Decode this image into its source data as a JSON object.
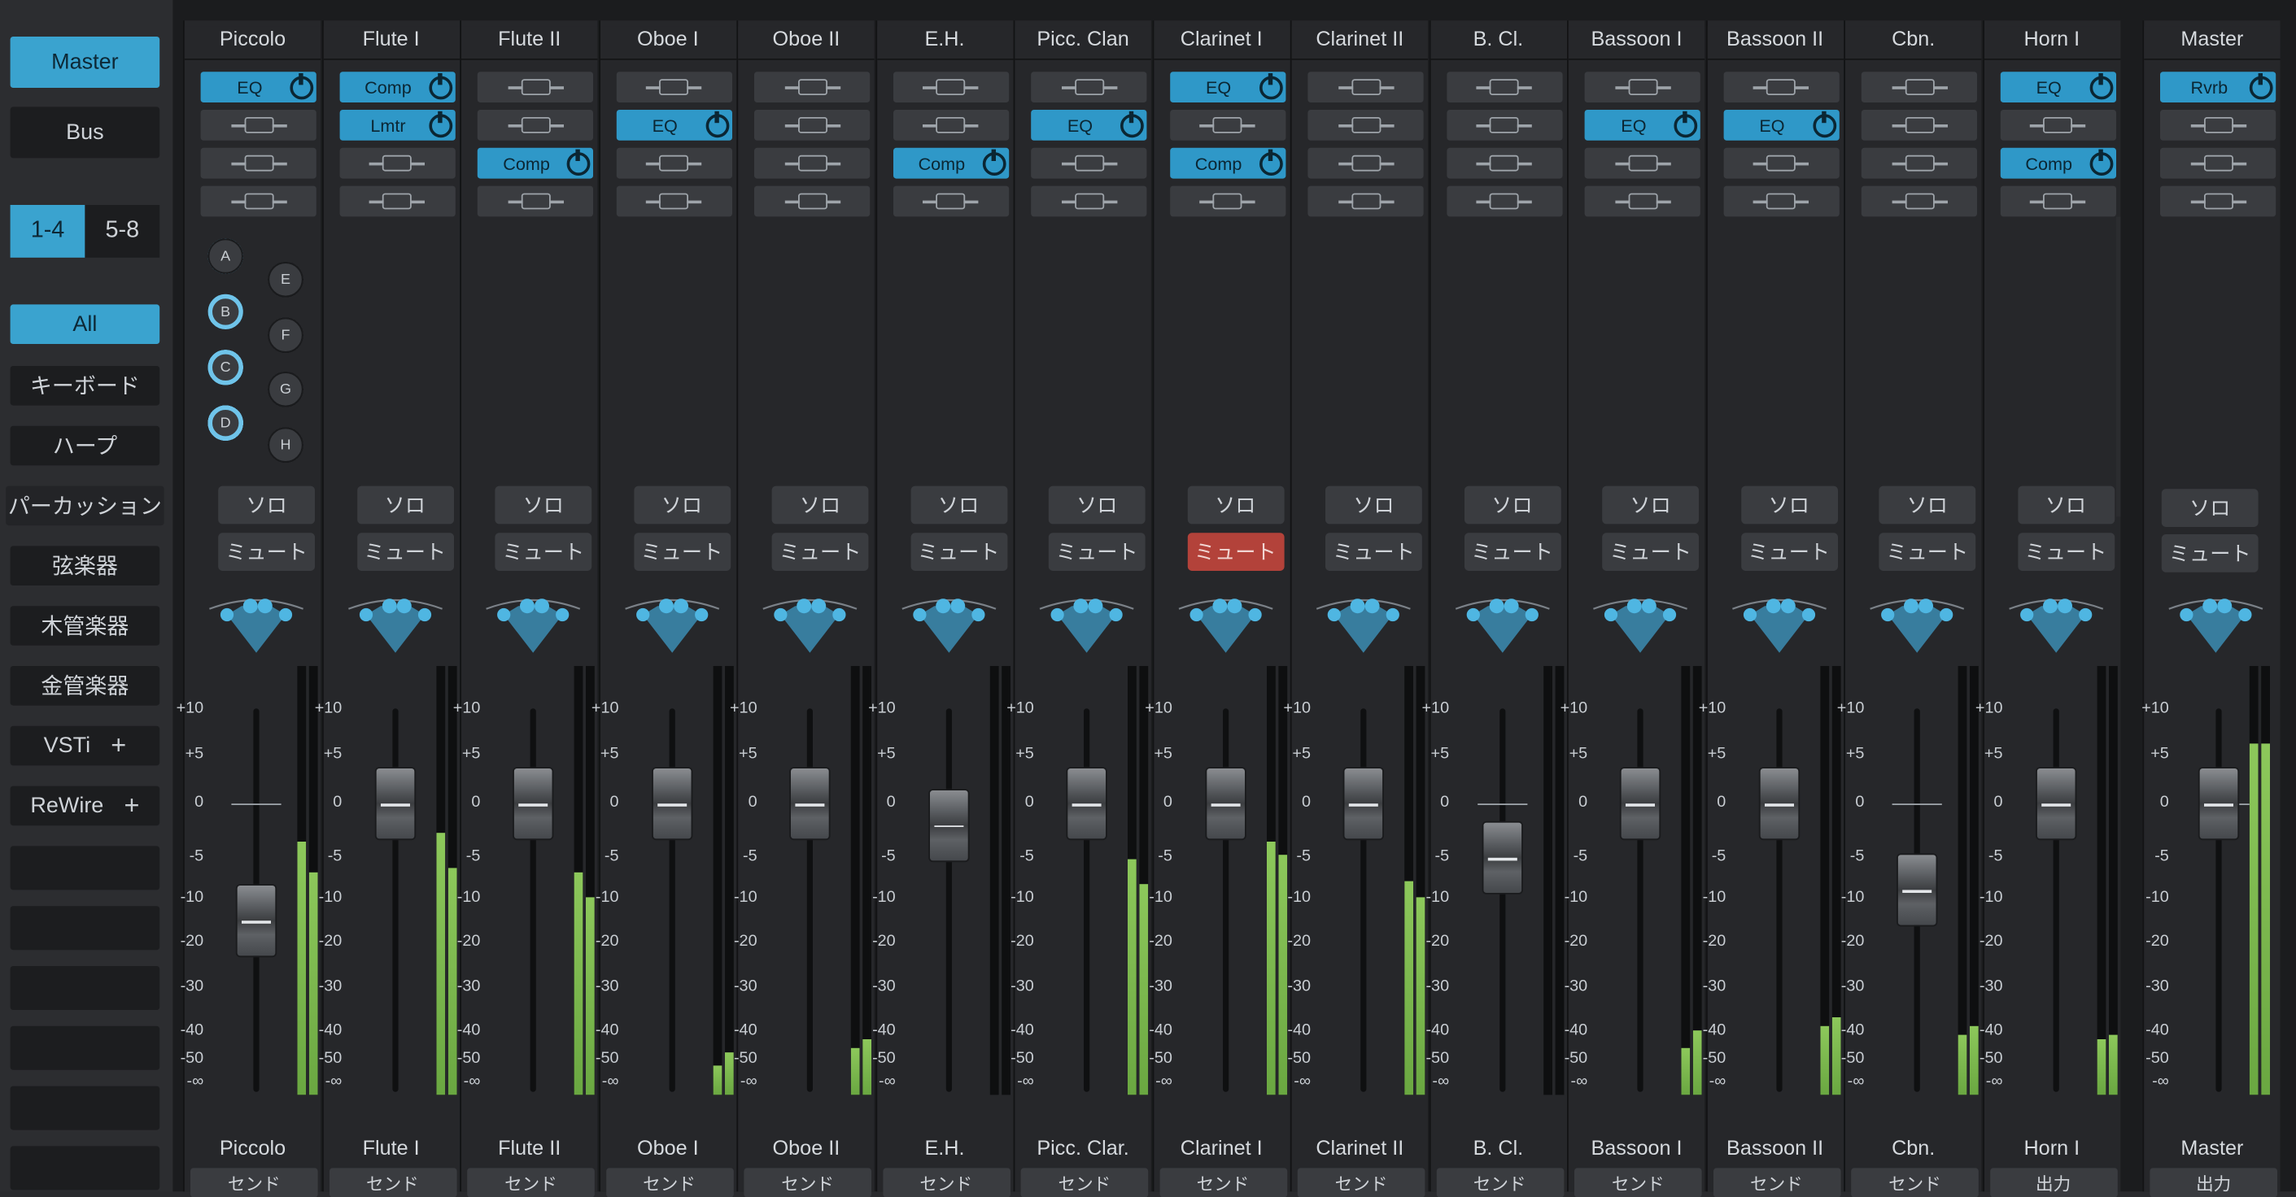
{
  "sidebar": {
    "master_label": "Master",
    "bus_label": "Bus",
    "bank_left": "1-4",
    "bank_right": "5-8",
    "categories": [
      "All",
      "キーボード",
      "ハープ",
      "パーカッション",
      "弦楽器",
      "木管楽器",
      "金管楽器"
    ],
    "vsti_label": "VSTi",
    "rewire_label": "ReWire"
  },
  "channels": [
    {
      "name": "Piccolo",
      "footer": "Piccolo",
      "send": "センド",
      "inserts": [
        "EQ",
        "",
        "",
        ""
      ],
      "sends_on": [
        true,
        false,
        false,
        true,
        false,
        false,
        false,
        false
      ],
      "muted": false,
      "fader_db": -15,
      "meter_level": [
        0.59,
        0.52
      ]
    },
    {
      "name": "Flute I",
      "footer": "Flute I",
      "send": "センド",
      "inserts": [
        "Comp",
        "Lmtr",
        "",
        ""
      ],
      "sends_on": [
        true,
        false,
        false,
        true,
        false,
        false,
        false,
        false
      ],
      "muted": false,
      "fader_db": 0,
      "meter_level": [
        0.61,
        0.53
      ]
    },
    {
      "name": "Flute II",
      "footer": "Flute II",
      "send": "センド",
      "inserts": [
        "",
        "",
        "Comp",
        ""
      ],
      "sends_on": [
        true,
        false,
        false,
        true,
        false,
        false,
        false,
        false
      ],
      "muted": false,
      "fader_db": 0,
      "meter_level": [
        0.52,
        0.46
      ]
    },
    {
      "name": "Oboe I",
      "footer": "Oboe I",
      "send": "センド",
      "inserts": [
        "",
        "EQ",
        "",
        ""
      ],
      "sends_on": [
        false,
        false,
        true,
        true,
        false,
        false,
        false,
        false
      ],
      "muted": false,
      "fader_db": 0,
      "meter_level": [
        0.07,
        0.1
      ]
    },
    {
      "name": "Oboe II",
      "footer": "Oboe II",
      "send": "センド",
      "inserts": [
        "",
        "",
        "",
        ""
      ],
      "sends_on": [
        false,
        false,
        true,
        true,
        false,
        false,
        false,
        false
      ],
      "muted": false,
      "fader_db": 0,
      "meter_level": [
        0.11,
        0.13
      ]
    },
    {
      "name": "E.H.",
      "footer": "E.H.",
      "send": "センド",
      "inserts": [
        "",
        "",
        "Comp",
        ""
      ],
      "sends_on": [
        false,
        false,
        true,
        true,
        false,
        false,
        false,
        false
      ],
      "muted": false,
      "fader_db": -2,
      "meter_level": [
        0,
        0
      ]
    },
    {
      "name": "Picc. Clan",
      "footer": "Picc. Clar.",
      "send": "センド",
      "inserts": [
        "",
        "EQ",
        "",
        ""
      ],
      "sends_on": [
        true,
        false,
        false,
        true,
        false,
        false,
        false,
        false
      ],
      "muted": false,
      "fader_db": 0,
      "meter_level": [
        0.55,
        0.49
      ]
    },
    {
      "name": "Clarinet I",
      "footer": "Clarinet I",
      "send": "センド",
      "inserts": [
        "EQ",
        "",
        "Comp",
        ""
      ],
      "sends_on": [
        true,
        true,
        false,
        true,
        false,
        false,
        false,
        false
      ],
      "muted": true,
      "fader_db": 0,
      "meter_level": [
        0.59,
        0.56
      ]
    },
    {
      "name": "Clarinet II",
      "footer": "Clarinet II",
      "send": "センド",
      "inserts": [
        "",
        "",
        "",
        ""
      ],
      "sends_on": [
        true,
        true,
        false,
        true,
        false,
        false,
        false,
        false
      ],
      "muted": false,
      "fader_db": 0,
      "meter_level": [
        0.5,
        0.46
      ]
    },
    {
      "name": "B. Cl.",
      "footer": "B. Cl.",
      "send": "センド",
      "inserts": [
        "",
        "",
        "",
        ""
      ],
      "sends_on": [
        true,
        true,
        false,
        true,
        false,
        false,
        false,
        false
      ],
      "muted": false,
      "fader_db": -5,
      "meter_level": [
        0,
        0
      ]
    },
    {
      "name": "Bassoon I",
      "footer": "Bassoon I",
      "send": "センド",
      "inserts": [
        "",
        "EQ",
        "",
        ""
      ],
      "sends_on": [
        false,
        false,
        true,
        true,
        false,
        false,
        false,
        false
      ],
      "muted": false,
      "fader_db": 0,
      "meter_level": [
        0.11,
        0.15
      ]
    },
    {
      "name": "Bassoon II",
      "footer": "Bassoon II",
      "send": "センド",
      "inserts": [
        "",
        "EQ",
        "",
        ""
      ],
      "sends_on": [
        false,
        false,
        true,
        true,
        false,
        false,
        false,
        false
      ],
      "muted": false,
      "fader_db": 0,
      "meter_level": [
        0.16,
        0.18
      ]
    },
    {
      "name": "Cbn.",
      "footer": "Cbn.",
      "send": "センド",
      "inserts": [
        "",
        "",
        "",
        ""
      ],
      "sends_on": [
        false,
        false,
        true,
        true,
        false,
        false,
        false,
        false
      ],
      "muted": false,
      "fader_db": -9,
      "meter_level": [
        0.14,
        0.16
      ]
    },
    {
      "name": "Horn I",
      "footer": "Horn I",
      "send": "出力",
      "inserts": [
        "EQ",
        "",
        "Comp",
        ""
      ],
      "sends_on": [
        false,
        true,
        true,
        true,
        false,
        false,
        false,
        false
      ],
      "muted": false,
      "fader_db": 0,
      "meter_level": [
        0.13,
        0.14
      ]
    }
  ],
  "master": {
    "name": "Master",
    "footer": "Master",
    "send": "出力",
    "inserts": [
      "Rvrb",
      "",
      "",
      ""
    ],
    "fader_db": 0,
    "meter_level": [
      0.82,
      0.82
    ]
  },
  "send_letters": [
    "A",
    "B",
    "C",
    "D",
    "E",
    "F",
    "G",
    "H"
  ],
  "solo_label": "ソロ",
  "mute_label": "ミュート",
  "scale_labels": [
    "+10",
    "+5",
    "0",
    "-5",
    "-10",
    "-20",
    "-30",
    "-40",
    "-50",
    "-∞"
  ],
  "colors": {
    "accent": "#3aa3cf",
    "mute_active": "#b3423a",
    "meter": "#7bb84e"
  }
}
